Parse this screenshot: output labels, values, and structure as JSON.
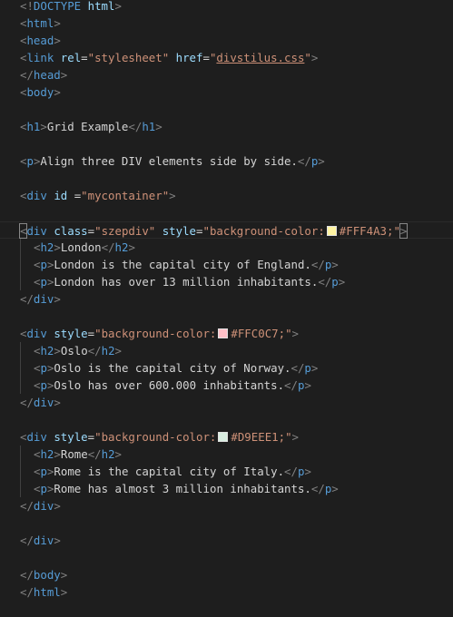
{
  "editor": {
    "language": "html",
    "colors": {
      "background": "#1e1e1e",
      "punctuation": "#808080",
      "tag": "#569cd6",
      "attribute": "#9cdcfe",
      "string": "#ce9178",
      "text": "#d4d4d4"
    },
    "active_line": 13,
    "lines": [
      {
        "indent": 0,
        "tokens": [
          {
            "t": "punct",
            "v": "<!"
          },
          {
            "t": "tag",
            "v": "DOCTYPE"
          },
          {
            "t": "text",
            "v": " "
          },
          {
            "t": "attr",
            "v": "html"
          },
          {
            "t": "punct",
            "v": ">"
          }
        ]
      },
      {
        "indent": 0,
        "tokens": [
          {
            "t": "punct",
            "v": "<"
          },
          {
            "t": "tag",
            "v": "html"
          },
          {
            "t": "punct",
            "v": ">"
          }
        ]
      },
      {
        "indent": 0,
        "tokens": [
          {
            "t": "punct",
            "v": "<"
          },
          {
            "t": "tag",
            "v": "head"
          },
          {
            "t": "punct",
            "v": ">"
          }
        ]
      },
      {
        "indent": 0,
        "tokens": [
          {
            "t": "punct",
            "v": "<"
          },
          {
            "t": "tag",
            "v": "link"
          },
          {
            "t": "text",
            "v": " "
          },
          {
            "t": "attr",
            "v": "rel"
          },
          {
            "t": "text",
            "v": "="
          },
          {
            "t": "str",
            "v": "\"stylesheet\""
          },
          {
            "t": "text",
            "v": " "
          },
          {
            "t": "attr",
            "v": "href"
          },
          {
            "t": "text",
            "v": "="
          },
          {
            "t": "str",
            "v": "\""
          },
          {
            "t": "link",
            "v": "divstilus.css"
          },
          {
            "t": "str",
            "v": "\""
          },
          {
            "t": "punct",
            "v": ">"
          }
        ]
      },
      {
        "indent": 0,
        "tokens": [
          {
            "t": "punct",
            "v": "</"
          },
          {
            "t": "tag",
            "v": "head"
          },
          {
            "t": "punct",
            "v": ">"
          }
        ]
      },
      {
        "indent": 0,
        "tokens": [
          {
            "t": "punct",
            "v": "<"
          },
          {
            "t": "tag",
            "v": "body"
          },
          {
            "t": "punct",
            "v": ">"
          }
        ]
      },
      {
        "indent": 0,
        "tokens": []
      },
      {
        "indent": 0,
        "tokens": [
          {
            "t": "punct",
            "v": "<"
          },
          {
            "t": "tag",
            "v": "h1"
          },
          {
            "t": "punct",
            "v": ">"
          },
          {
            "t": "text",
            "v": "Grid Example"
          },
          {
            "t": "punct",
            "v": "</"
          },
          {
            "t": "tag",
            "v": "h1"
          },
          {
            "t": "punct",
            "v": ">"
          }
        ]
      },
      {
        "indent": 0,
        "tokens": []
      },
      {
        "indent": 0,
        "tokens": [
          {
            "t": "punct",
            "v": "<"
          },
          {
            "t": "tag",
            "v": "p"
          },
          {
            "t": "punct",
            "v": ">"
          },
          {
            "t": "text",
            "v": "Align three DIV elements side by side."
          },
          {
            "t": "punct",
            "v": "</"
          },
          {
            "t": "tag",
            "v": "p"
          },
          {
            "t": "punct",
            "v": ">"
          }
        ]
      },
      {
        "indent": 0,
        "tokens": []
      },
      {
        "indent": 0,
        "tokens": [
          {
            "t": "punct",
            "v": "<"
          },
          {
            "t": "tag",
            "v": "div"
          },
          {
            "t": "text",
            "v": " "
          },
          {
            "t": "attr",
            "v": "id"
          },
          {
            "t": "text",
            "v": " ="
          },
          {
            "t": "str",
            "v": "\"mycontainer\""
          },
          {
            "t": "punct",
            "v": ">"
          }
        ]
      },
      {
        "indent": 0,
        "tokens": []
      },
      {
        "indent": 0,
        "tokens": [
          {
            "t": "punct",
            "v": "<",
            "box": true
          },
          {
            "t": "tag",
            "v": "div"
          },
          {
            "t": "text",
            "v": " "
          },
          {
            "t": "attr",
            "v": "class"
          },
          {
            "t": "text",
            "v": "="
          },
          {
            "t": "str",
            "v": "\"szepdiv\""
          },
          {
            "t": "text",
            "v": " "
          },
          {
            "t": "attr",
            "v": "style"
          },
          {
            "t": "text",
            "v": "="
          },
          {
            "t": "str",
            "v": "\"background-color:"
          },
          {
            "t": "swatch",
            "v": "#FFF4A3"
          },
          {
            "t": "str",
            "v": "#FFF4A3;\""
          },
          {
            "t": "punct",
            "v": ">",
            "box": true
          }
        ]
      },
      {
        "indent": 1,
        "tokens": [
          {
            "t": "punct",
            "v": "<"
          },
          {
            "t": "tag",
            "v": "h2"
          },
          {
            "t": "punct",
            "v": ">"
          },
          {
            "t": "text",
            "v": "London"
          },
          {
            "t": "punct",
            "v": "</"
          },
          {
            "t": "tag",
            "v": "h2"
          },
          {
            "t": "punct",
            "v": ">"
          }
        ]
      },
      {
        "indent": 1,
        "tokens": [
          {
            "t": "punct",
            "v": "<"
          },
          {
            "t": "tag",
            "v": "p"
          },
          {
            "t": "punct",
            "v": ">"
          },
          {
            "t": "text",
            "v": "London is the capital city of England."
          },
          {
            "t": "punct",
            "v": "</"
          },
          {
            "t": "tag",
            "v": "p"
          },
          {
            "t": "punct",
            "v": ">"
          }
        ]
      },
      {
        "indent": 1,
        "tokens": [
          {
            "t": "punct",
            "v": "<"
          },
          {
            "t": "tag",
            "v": "p"
          },
          {
            "t": "punct",
            "v": ">"
          },
          {
            "t": "text",
            "v": "London has over 13 million inhabitants."
          },
          {
            "t": "punct",
            "v": "</"
          },
          {
            "t": "tag",
            "v": "p"
          },
          {
            "t": "punct",
            "v": ">"
          }
        ]
      },
      {
        "indent": 0,
        "tokens": [
          {
            "t": "punct",
            "v": "</"
          },
          {
            "t": "tag",
            "v": "div"
          },
          {
            "t": "punct",
            "v": ">"
          }
        ]
      },
      {
        "indent": 0,
        "tokens": []
      },
      {
        "indent": 0,
        "tokens": [
          {
            "t": "punct",
            "v": "<"
          },
          {
            "t": "tag",
            "v": "div"
          },
          {
            "t": "text",
            "v": " "
          },
          {
            "t": "attr",
            "v": "style"
          },
          {
            "t": "text",
            "v": "="
          },
          {
            "t": "str",
            "v": "\"background-color:"
          },
          {
            "t": "swatch",
            "v": "#FFC0C7"
          },
          {
            "t": "str",
            "v": "#FFC0C7;\""
          },
          {
            "t": "punct",
            "v": ">"
          }
        ]
      },
      {
        "indent": 1,
        "tokens": [
          {
            "t": "punct",
            "v": "<"
          },
          {
            "t": "tag",
            "v": "h2"
          },
          {
            "t": "punct",
            "v": ">"
          },
          {
            "t": "text",
            "v": "Oslo"
          },
          {
            "t": "punct",
            "v": "</"
          },
          {
            "t": "tag",
            "v": "h2"
          },
          {
            "t": "punct",
            "v": ">"
          }
        ]
      },
      {
        "indent": 1,
        "tokens": [
          {
            "t": "punct",
            "v": "<"
          },
          {
            "t": "tag",
            "v": "p"
          },
          {
            "t": "punct",
            "v": ">"
          },
          {
            "t": "text",
            "v": "Oslo is the capital city of Norway."
          },
          {
            "t": "punct",
            "v": "</"
          },
          {
            "t": "tag",
            "v": "p"
          },
          {
            "t": "punct",
            "v": ">"
          }
        ]
      },
      {
        "indent": 1,
        "tokens": [
          {
            "t": "punct",
            "v": "<"
          },
          {
            "t": "tag",
            "v": "p"
          },
          {
            "t": "punct",
            "v": ">"
          },
          {
            "t": "text",
            "v": "Oslo has over 600.000 inhabitants."
          },
          {
            "t": "punct",
            "v": "</"
          },
          {
            "t": "tag",
            "v": "p"
          },
          {
            "t": "punct",
            "v": ">"
          }
        ]
      },
      {
        "indent": 0,
        "tokens": [
          {
            "t": "punct",
            "v": "</"
          },
          {
            "t": "tag",
            "v": "div"
          },
          {
            "t": "punct",
            "v": ">"
          }
        ]
      },
      {
        "indent": 0,
        "tokens": []
      },
      {
        "indent": 0,
        "tokens": [
          {
            "t": "punct",
            "v": "<"
          },
          {
            "t": "tag",
            "v": "div"
          },
          {
            "t": "text",
            "v": " "
          },
          {
            "t": "attr",
            "v": "style"
          },
          {
            "t": "text",
            "v": "="
          },
          {
            "t": "str",
            "v": "\"background-color:"
          },
          {
            "t": "swatch",
            "v": "#D9EEE1"
          },
          {
            "t": "str",
            "v": "#D9EEE1;\""
          },
          {
            "t": "punct",
            "v": ">"
          }
        ]
      },
      {
        "indent": 1,
        "tokens": [
          {
            "t": "punct",
            "v": "<"
          },
          {
            "t": "tag",
            "v": "h2"
          },
          {
            "t": "punct",
            "v": ">"
          },
          {
            "t": "text",
            "v": "Rome"
          },
          {
            "t": "punct",
            "v": "</"
          },
          {
            "t": "tag",
            "v": "h2"
          },
          {
            "t": "punct",
            "v": ">"
          }
        ]
      },
      {
        "indent": 1,
        "tokens": [
          {
            "t": "punct",
            "v": "<"
          },
          {
            "t": "tag",
            "v": "p"
          },
          {
            "t": "punct",
            "v": ">"
          },
          {
            "t": "text",
            "v": "Rome is the capital city of Italy."
          },
          {
            "t": "punct",
            "v": "</"
          },
          {
            "t": "tag",
            "v": "p"
          },
          {
            "t": "punct",
            "v": ">"
          }
        ]
      },
      {
        "indent": 1,
        "tokens": [
          {
            "t": "punct",
            "v": "<"
          },
          {
            "t": "tag",
            "v": "p"
          },
          {
            "t": "punct",
            "v": ">"
          },
          {
            "t": "text",
            "v": "Rome has almost 3 million inhabitants."
          },
          {
            "t": "punct",
            "v": "</"
          },
          {
            "t": "tag",
            "v": "p"
          },
          {
            "t": "punct",
            "v": ">"
          }
        ]
      },
      {
        "indent": 0,
        "tokens": [
          {
            "t": "punct",
            "v": "</"
          },
          {
            "t": "tag",
            "v": "div"
          },
          {
            "t": "punct",
            "v": ">"
          }
        ]
      },
      {
        "indent": 0,
        "tokens": []
      },
      {
        "indent": 0,
        "tokens": [
          {
            "t": "punct",
            "v": "</"
          },
          {
            "t": "tag",
            "v": "div"
          },
          {
            "t": "punct",
            "v": ">"
          }
        ]
      },
      {
        "indent": 0,
        "tokens": []
      },
      {
        "indent": 0,
        "tokens": [
          {
            "t": "punct",
            "v": "</"
          },
          {
            "t": "tag",
            "v": "body"
          },
          {
            "t": "punct",
            "v": ">"
          }
        ]
      },
      {
        "indent": 0,
        "tokens": [
          {
            "t": "punct",
            "v": "</"
          },
          {
            "t": "tag",
            "v": "html"
          },
          {
            "t": "punct",
            "v": ">"
          }
        ]
      }
    ]
  }
}
